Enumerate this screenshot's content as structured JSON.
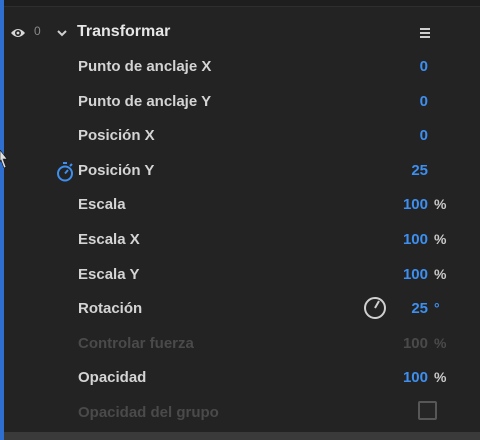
{
  "effect": {
    "title": "Transformar",
    "visibility_counter": "0",
    "icons": {
      "visibility": "eye-icon",
      "expand": "chevron-down-icon",
      "menu": "menu-icon",
      "keyframe": "stopwatch-icon",
      "rotation_dial": "dial-icon"
    },
    "colors": {
      "value": "#3d8ff0",
      "accent_rail": "#2f6fd0",
      "disabled": "#4a4a4a"
    }
  },
  "properties": [
    {
      "label": "Punto de anclaje X",
      "value": "0",
      "unit": ""
    },
    {
      "label": "Punto de anclaje Y",
      "value": "0",
      "unit": ""
    },
    {
      "label": "Posición X",
      "value": "0",
      "unit": ""
    },
    {
      "label": "Posición Y",
      "value": "25",
      "unit": ""
    },
    {
      "label": "Escala",
      "value": "100",
      "unit": "%"
    },
    {
      "label": "Escala X",
      "value": "100",
      "unit": "%"
    },
    {
      "label": "Escala Y",
      "value": "100",
      "unit": "%"
    },
    {
      "label": "Rotación",
      "value": "25",
      "unit": "°"
    },
    {
      "label": "Controlar fuerza",
      "value": "100",
      "unit": "%"
    },
    {
      "label": "Opacidad",
      "value": "100",
      "unit": "%"
    },
    {
      "label": "Opacidad del grupo",
      "checked": false
    }
  ]
}
